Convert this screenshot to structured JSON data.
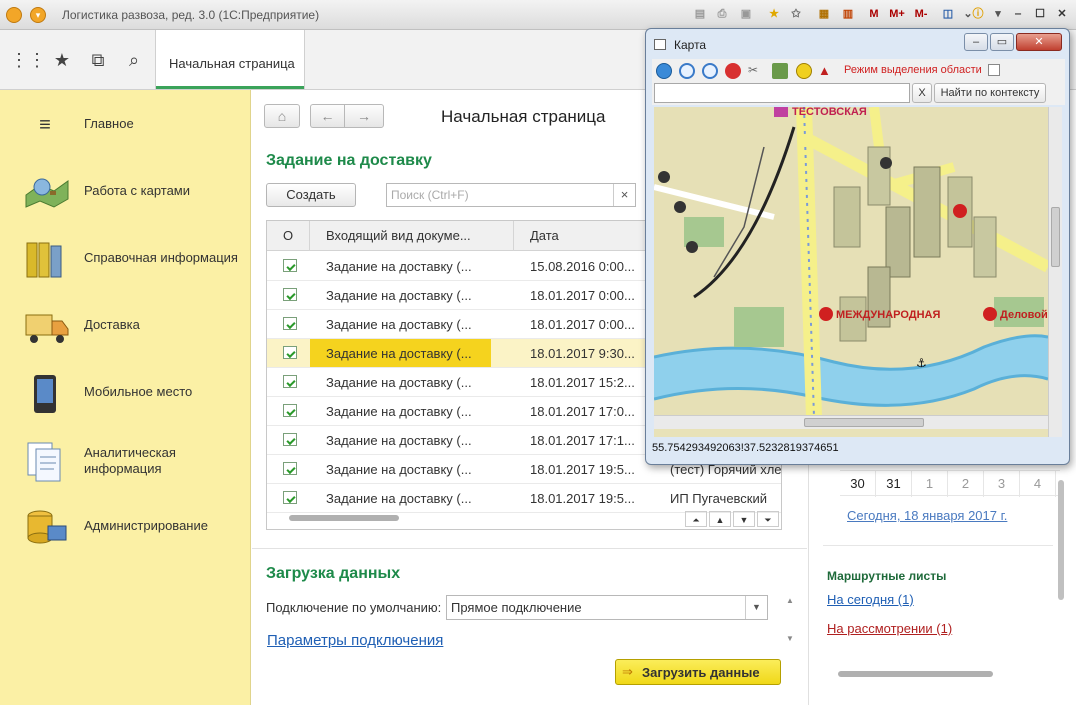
{
  "window": {
    "title": "Логистика развоза, ред. 3.0  (1С:Предприятие)"
  },
  "toolbar": {
    "m_label": "M",
    "mplus_label": "M+",
    "mminus_label": "M-"
  },
  "tabs": {
    "home": "Начальная страница"
  },
  "sidebar": {
    "items": [
      {
        "label": "Главное",
        "icon": "menu-icon"
      },
      {
        "label": "Работа с картами",
        "icon": "map-icon"
      },
      {
        "label": "Справочная информация",
        "icon": "binders-icon"
      },
      {
        "label": "Доставка",
        "icon": "truck-icon"
      },
      {
        "label": "Мобильное место",
        "icon": "mobile-icon"
      },
      {
        "label": "Аналитическая информация",
        "icon": "document-icon"
      },
      {
        "label": "Администрирование",
        "icon": "database-icon"
      }
    ]
  },
  "page": {
    "title": "Начальная страница"
  },
  "delivery": {
    "heading": "Задание на доставку",
    "create_label": "Создать",
    "search_placeholder": "Поиск (Ctrl+F)",
    "clear_label": "×",
    "columns": {
      "o": "О",
      "doc": "Входящий вид докуме...",
      "date": "Дата"
    },
    "rows": [
      {
        "doc": "Задание на доставку (...",
        "date": "15.08.2016 0:00...",
        "extra": ""
      },
      {
        "doc": "Задание на доставку (...",
        "date": "18.01.2017 0:00...",
        "extra": ""
      },
      {
        "doc": "Задание на доставку (...",
        "date": "18.01.2017 0:00...",
        "extra": ""
      },
      {
        "doc": "Задание на доставку (...",
        "date": "18.01.2017 9:30...",
        "extra": ""
      },
      {
        "doc": "Задание на доставку (...",
        "date": "18.01.2017 15:2...",
        "extra": ""
      },
      {
        "doc": "Задание на доставку (...",
        "date": "18.01.2017 17:0...",
        "extra": ""
      },
      {
        "doc": "Задание на доставку (...",
        "date": "18.01.2017 17:1...",
        "extra": ""
      },
      {
        "doc": "Задание на доставку (...",
        "date": "18.01.2017 19:5...",
        "extra": "(тест) Горячий хле"
      },
      {
        "doc": "Задание на доставку (...",
        "date": "18.01.2017 19:5...",
        "extra": "ИП Пугачевский"
      }
    ]
  },
  "load": {
    "heading": "Загрузка данных",
    "conn_label": "Подключение по умолчанию:",
    "conn_value": "Прямое подключение",
    "params_link": "Параметры подключения",
    "load_button": "Загрузить данные"
  },
  "calendar": {
    "days": [
      "30",
      "31",
      "1",
      "2",
      "3",
      "4"
    ],
    "today_link": "Сегодня, 18 января 2017 г."
  },
  "routes": {
    "heading": "Маршрутные листы",
    "today_link": "На сегодня (1)",
    "review_link": "На рассмотрении (1)"
  },
  "map": {
    "title": "Карта",
    "mode_label": "Режим выделения области",
    "x_label": "X",
    "search_button": "Найти по контексту",
    "station1": "МЕЖДУНАРОДНАЯ",
    "station2": "Деловой",
    "station3": "ТЕСТОВСКАЯ",
    "coords": "55.754293492063!37.5232819374651"
  },
  "colors": {
    "accent_green": "#1e8a4a",
    "sidebar_bg": "#fbf0a5",
    "selected_row": "#f5d31e",
    "load_button": "#f5e22a"
  }
}
